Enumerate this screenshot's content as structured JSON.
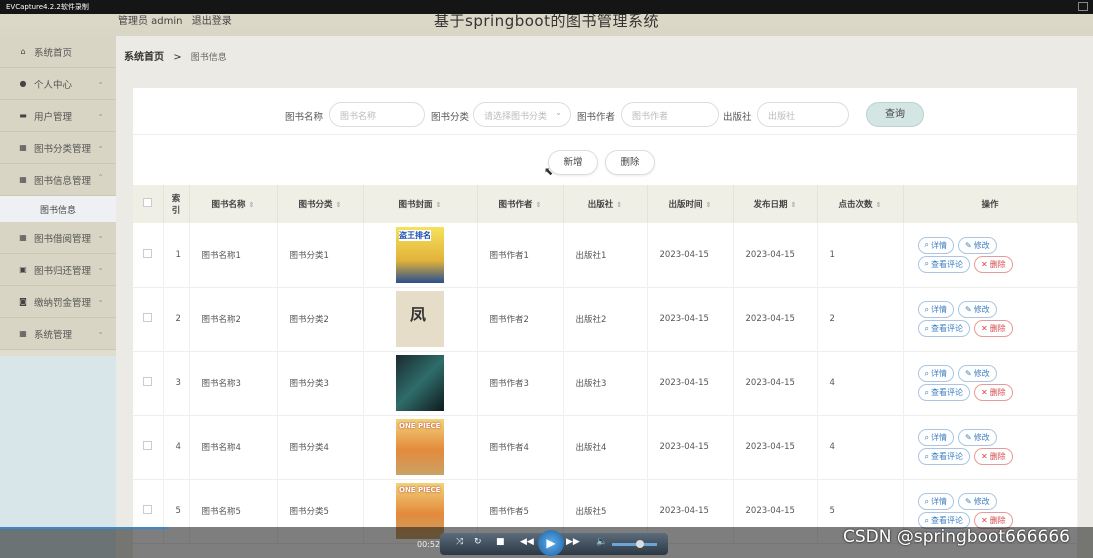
{
  "capture": {
    "title": "EVCapture4.2.2软件录制"
  },
  "header": {
    "admin_label": "管理员 admin",
    "logout": "退出登录",
    "system_title": "基于springboot的图书管理系统"
  },
  "sidebar": {
    "items": [
      {
        "label": "系统首页",
        "icon": "home-icon",
        "glyph": "⌂"
      },
      {
        "label": "个人中心",
        "icon": "user-icon",
        "glyph": "●"
      },
      {
        "label": "用户管理",
        "icon": "user-manage-icon",
        "glyph": "▬"
      },
      {
        "label": "图书分类管理",
        "icon": "grid-icon",
        "glyph": "▦"
      },
      {
        "label": "图书信息管理",
        "icon": "grid-icon",
        "glyph": "▦"
      },
      {
        "label": "图书借阅管理",
        "icon": "grid-icon",
        "glyph": "▦"
      },
      {
        "label": "图书归还管理",
        "icon": "return-icon",
        "glyph": "▣"
      },
      {
        "label": "缴纳罚金管理",
        "icon": "fine-icon",
        "glyph": "◙"
      },
      {
        "label": "系统管理",
        "icon": "system-icon",
        "glyph": "▦"
      }
    ],
    "submenu_active": "图书信息"
  },
  "breadcrumb": {
    "home": "系统首页",
    "sep": ">",
    "current": "图书信息"
  },
  "search": {
    "name_label": "图书名称",
    "name_placeholder": "图书名称",
    "category_label": "图书分类",
    "category_placeholder": "请选择图书分类",
    "author_label": "图书作者",
    "author_placeholder": "图书作者",
    "publisher_label": "出版社",
    "publisher_placeholder": "出版社",
    "query": "查询"
  },
  "actions": {
    "add": "新增",
    "delete": "删除"
  },
  "table": {
    "headers": [
      "索引",
      "图书名称",
      "图书分类",
      "图书封面",
      "图书作者",
      "出版社",
      "出版时间",
      "发布日期",
      "点击次数",
      "操作"
    ],
    "index_header_line1": "索",
    "index_header_line2": "引",
    "rows": [
      {
        "idx": "1",
        "name": "图书名称1",
        "cat": "图书分类1",
        "cover": "盗王排名",
        "author": "图书作者1",
        "pub": "出版社1",
        "pubdate": "2023-04-15",
        "reldate": "2023-04-15",
        "clicks": "1"
      },
      {
        "idx": "2",
        "name": "图书名称2",
        "cat": "图书分类2",
        "cover": "凤",
        "author": "图书作者2",
        "pub": "出版社2",
        "pubdate": "2023-04-15",
        "reldate": "2023-04-15",
        "clicks": "2"
      },
      {
        "idx": "3",
        "name": "图书名称3",
        "cat": "图书分类3",
        "cover": "",
        "author": "图书作者3",
        "pub": "出版社3",
        "pubdate": "2023-04-15",
        "reldate": "2023-04-15",
        "clicks": "4"
      },
      {
        "idx": "4",
        "name": "图书名称4",
        "cat": "图书分类4",
        "cover": "ONE PIECE",
        "author": "图书作者4",
        "pub": "出版社4",
        "pubdate": "2023-04-15",
        "reldate": "2023-04-15",
        "clicks": "4"
      },
      {
        "idx": "5",
        "name": "图书名称5",
        "cat": "图书分类5",
        "cover": "ONE PIECE",
        "author": "图书作者5",
        "pub": "出版社5",
        "pubdate": "2023-04-15",
        "reldate": "2023-04-15",
        "clicks": "5"
      }
    ],
    "ops": {
      "detail": "详情",
      "edit": "修改",
      "comments": "查看评论",
      "delete": "删除"
    }
  },
  "player": {
    "time": "00:52"
  },
  "watermark": "CSDN @springboot666666"
}
